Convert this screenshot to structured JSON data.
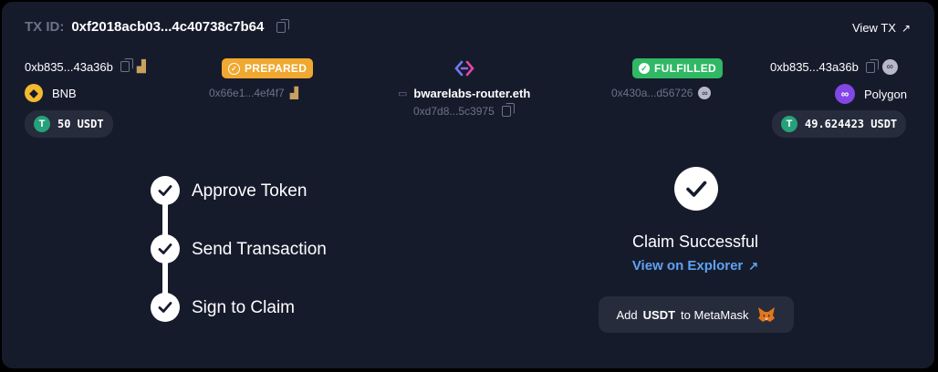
{
  "header": {
    "tx_label": "TX ID:",
    "tx_id": "0xf2018acb03...4c40738c7b64",
    "view_tx": "View TX"
  },
  "sender": {
    "address": "0xb835...43a36b",
    "chain": "BNB",
    "amount": "50 USDT"
  },
  "prepared": {
    "status": "PREPARED",
    "tx": "0x66e1...4ef4f7"
  },
  "router": {
    "name": "bwarelabs-router.eth",
    "address": "0xd7d8...5c3975"
  },
  "fulfilled": {
    "status": "FULFILLED",
    "tx": "0x430a...d56726"
  },
  "receiver": {
    "address": "0xb835...43a36b",
    "chain": "Polygon",
    "amount": "49.624423 USDT"
  },
  "steps": [
    {
      "label": "Approve Token"
    },
    {
      "label": "Send Transaction"
    },
    {
      "label": "Sign to Claim"
    }
  ],
  "result": {
    "title": "Claim Successful",
    "explorer_link": "View on Explorer",
    "add_prefix": "Add",
    "add_token": "USDT",
    "add_suffix": "to MetaMask"
  },
  "colors": {
    "prepared": "#f0a830",
    "fulfilled": "#30b864",
    "link": "#5ea2f0",
    "usdt": "#26a17b",
    "bnb": "#f3ba2f",
    "polygon": "#8247e5"
  }
}
